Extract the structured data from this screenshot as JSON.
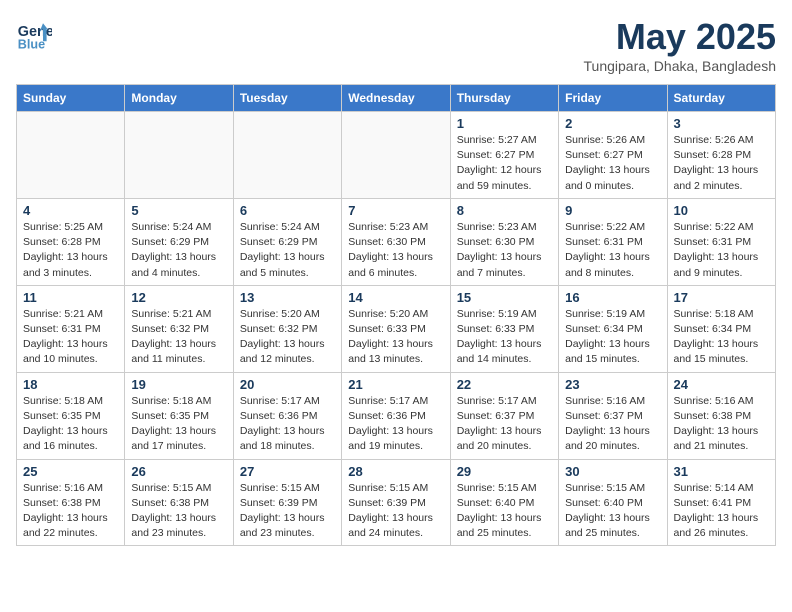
{
  "header": {
    "logo_line1": "General",
    "logo_line2": "Blue",
    "month": "May 2025",
    "location": "Tungipara, Dhaka, Bangladesh"
  },
  "weekdays": [
    "Sunday",
    "Monday",
    "Tuesday",
    "Wednesday",
    "Thursday",
    "Friday",
    "Saturday"
  ],
  "weeks": [
    [
      {
        "day": "",
        "info": ""
      },
      {
        "day": "",
        "info": ""
      },
      {
        "day": "",
        "info": ""
      },
      {
        "day": "",
        "info": ""
      },
      {
        "day": "1",
        "info": "Sunrise: 5:27 AM\nSunset: 6:27 PM\nDaylight: 12 hours\nand 59 minutes."
      },
      {
        "day": "2",
        "info": "Sunrise: 5:26 AM\nSunset: 6:27 PM\nDaylight: 13 hours\nand 0 minutes."
      },
      {
        "day": "3",
        "info": "Sunrise: 5:26 AM\nSunset: 6:28 PM\nDaylight: 13 hours\nand 2 minutes."
      }
    ],
    [
      {
        "day": "4",
        "info": "Sunrise: 5:25 AM\nSunset: 6:28 PM\nDaylight: 13 hours\nand 3 minutes."
      },
      {
        "day": "5",
        "info": "Sunrise: 5:24 AM\nSunset: 6:29 PM\nDaylight: 13 hours\nand 4 minutes."
      },
      {
        "day": "6",
        "info": "Sunrise: 5:24 AM\nSunset: 6:29 PM\nDaylight: 13 hours\nand 5 minutes."
      },
      {
        "day": "7",
        "info": "Sunrise: 5:23 AM\nSunset: 6:30 PM\nDaylight: 13 hours\nand 6 minutes."
      },
      {
        "day": "8",
        "info": "Sunrise: 5:23 AM\nSunset: 6:30 PM\nDaylight: 13 hours\nand 7 minutes."
      },
      {
        "day": "9",
        "info": "Sunrise: 5:22 AM\nSunset: 6:31 PM\nDaylight: 13 hours\nand 8 minutes."
      },
      {
        "day": "10",
        "info": "Sunrise: 5:22 AM\nSunset: 6:31 PM\nDaylight: 13 hours\nand 9 minutes."
      }
    ],
    [
      {
        "day": "11",
        "info": "Sunrise: 5:21 AM\nSunset: 6:31 PM\nDaylight: 13 hours\nand 10 minutes."
      },
      {
        "day": "12",
        "info": "Sunrise: 5:21 AM\nSunset: 6:32 PM\nDaylight: 13 hours\nand 11 minutes."
      },
      {
        "day": "13",
        "info": "Sunrise: 5:20 AM\nSunset: 6:32 PM\nDaylight: 13 hours\nand 12 minutes."
      },
      {
        "day": "14",
        "info": "Sunrise: 5:20 AM\nSunset: 6:33 PM\nDaylight: 13 hours\nand 13 minutes."
      },
      {
        "day": "15",
        "info": "Sunrise: 5:19 AM\nSunset: 6:33 PM\nDaylight: 13 hours\nand 14 minutes."
      },
      {
        "day": "16",
        "info": "Sunrise: 5:19 AM\nSunset: 6:34 PM\nDaylight: 13 hours\nand 15 minutes."
      },
      {
        "day": "17",
        "info": "Sunrise: 5:18 AM\nSunset: 6:34 PM\nDaylight: 13 hours\nand 15 minutes."
      }
    ],
    [
      {
        "day": "18",
        "info": "Sunrise: 5:18 AM\nSunset: 6:35 PM\nDaylight: 13 hours\nand 16 minutes."
      },
      {
        "day": "19",
        "info": "Sunrise: 5:18 AM\nSunset: 6:35 PM\nDaylight: 13 hours\nand 17 minutes."
      },
      {
        "day": "20",
        "info": "Sunrise: 5:17 AM\nSunset: 6:36 PM\nDaylight: 13 hours\nand 18 minutes."
      },
      {
        "day": "21",
        "info": "Sunrise: 5:17 AM\nSunset: 6:36 PM\nDaylight: 13 hours\nand 19 minutes."
      },
      {
        "day": "22",
        "info": "Sunrise: 5:17 AM\nSunset: 6:37 PM\nDaylight: 13 hours\nand 20 minutes."
      },
      {
        "day": "23",
        "info": "Sunrise: 5:16 AM\nSunset: 6:37 PM\nDaylight: 13 hours\nand 20 minutes."
      },
      {
        "day": "24",
        "info": "Sunrise: 5:16 AM\nSunset: 6:38 PM\nDaylight: 13 hours\nand 21 minutes."
      }
    ],
    [
      {
        "day": "25",
        "info": "Sunrise: 5:16 AM\nSunset: 6:38 PM\nDaylight: 13 hours\nand 22 minutes."
      },
      {
        "day": "26",
        "info": "Sunrise: 5:15 AM\nSunset: 6:38 PM\nDaylight: 13 hours\nand 23 minutes."
      },
      {
        "day": "27",
        "info": "Sunrise: 5:15 AM\nSunset: 6:39 PM\nDaylight: 13 hours\nand 23 minutes."
      },
      {
        "day": "28",
        "info": "Sunrise: 5:15 AM\nSunset: 6:39 PM\nDaylight: 13 hours\nand 24 minutes."
      },
      {
        "day": "29",
        "info": "Sunrise: 5:15 AM\nSunset: 6:40 PM\nDaylight: 13 hours\nand 25 minutes."
      },
      {
        "day": "30",
        "info": "Sunrise: 5:15 AM\nSunset: 6:40 PM\nDaylight: 13 hours\nand 25 minutes."
      },
      {
        "day": "31",
        "info": "Sunrise: 5:14 AM\nSunset: 6:41 PM\nDaylight: 13 hours\nand 26 minutes."
      }
    ]
  ]
}
